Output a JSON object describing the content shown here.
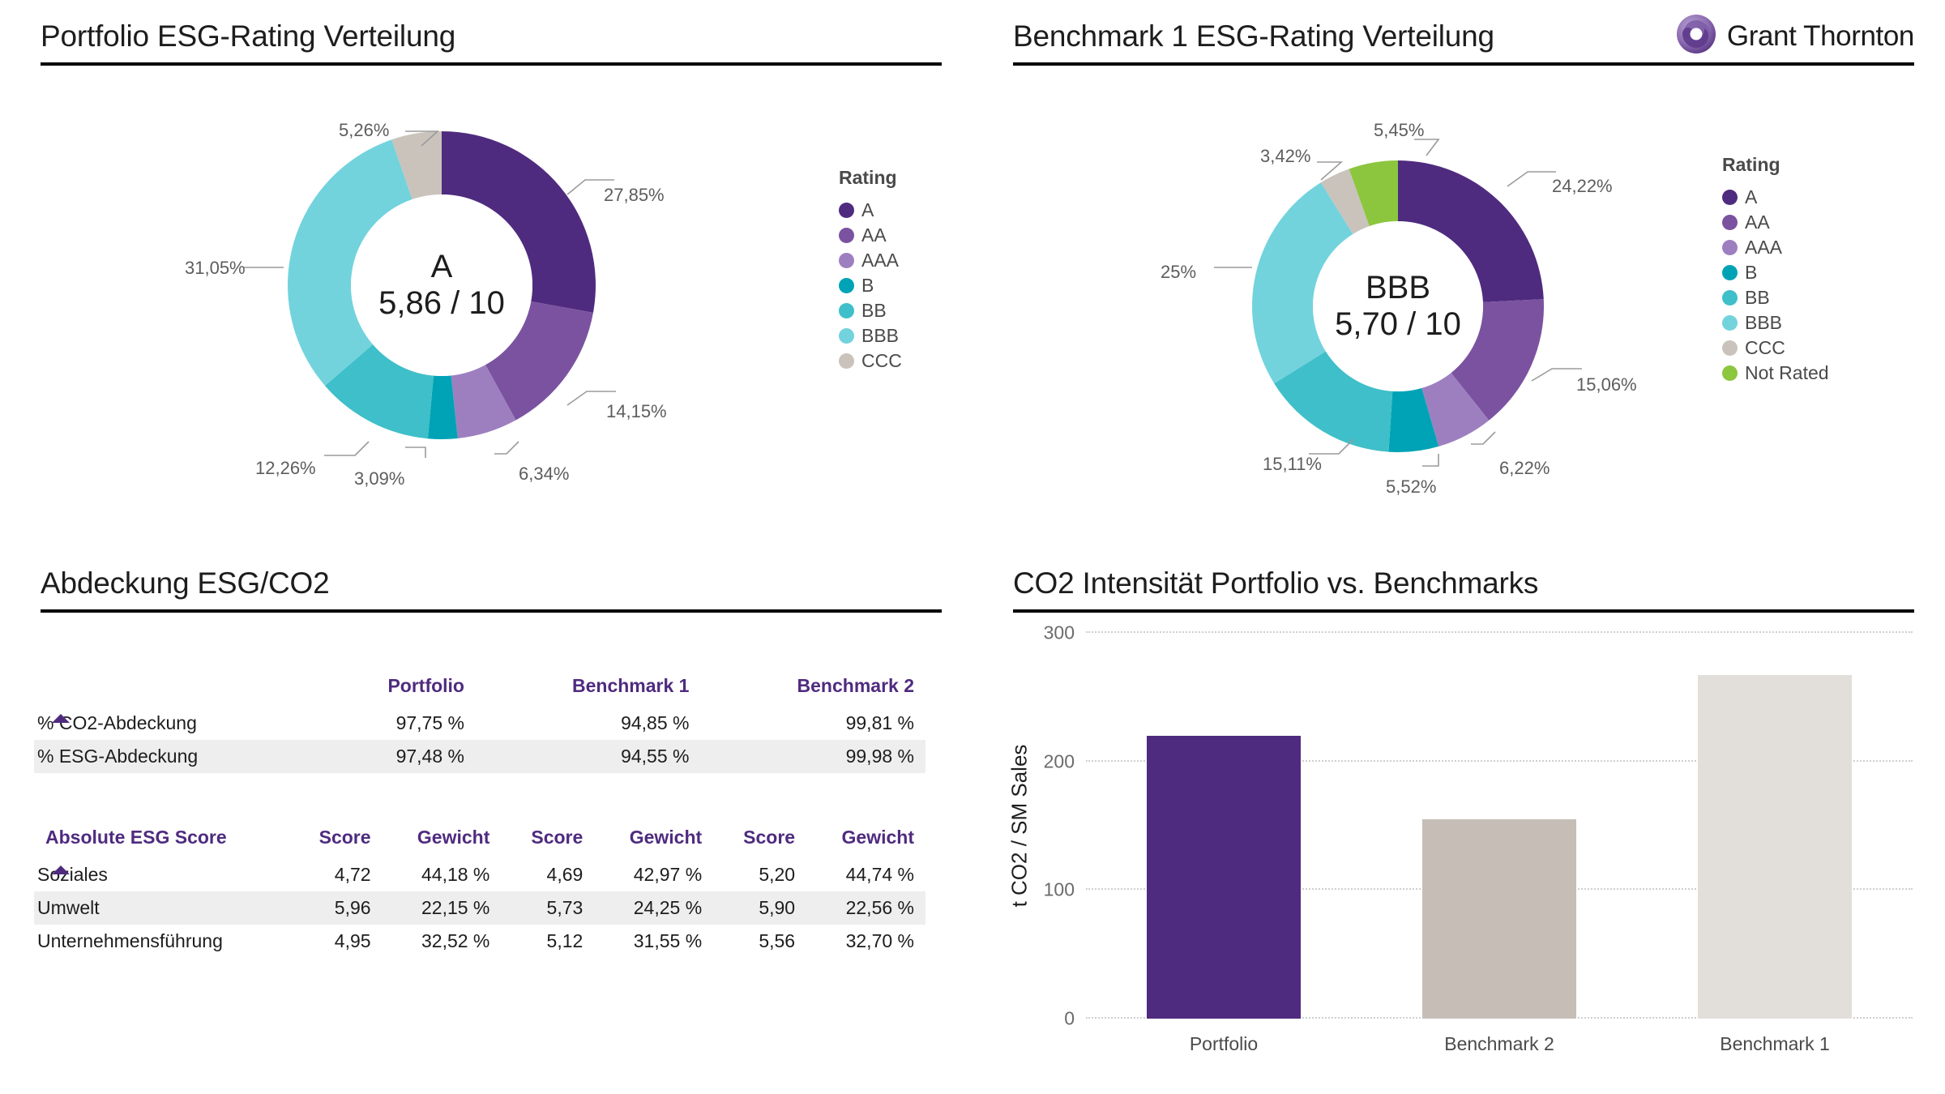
{
  "brand": {
    "name": "Grant Thornton",
    "logo_icon": "grant-thornton-swirl-icon",
    "purple": "#4F2B7F",
    "logo_purple_light": "#9E86C4"
  },
  "panels": {
    "portfolio_rating": {
      "title": "Portfolio ESG-Rating Verteilung"
    },
    "benchmark_rating": {
      "title": "Benchmark 1 ESG-Rating Verteilung"
    },
    "coverage": {
      "title": "Abdeckung ESG/CO2"
    },
    "co2_intensity": {
      "title": "CO2 Intensität Portfolio vs. Benchmarks"
    }
  },
  "legend_title": "Rating",
  "chart_data": [
    {
      "type": "pie",
      "title": "Portfolio ESG-Rating Verteilung",
      "center_rating": "A",
      "center_score": "5,86 / 10",
      "legend_title": "Rating",
      "legend_position": "right",
      "categories": [
        "A",
        "AA",
        "AAA",
        "B",
        "BB",
        "BBB",
        "CCC"
      ],
      "values": [
        27.85,
        14.15,
        6.34,
        3.09,
        12.26,
        31.05,
        5.26
      ],
      "labels": [
        "27,85%",
        "14,15%",
        "6,34%",
        "3,09%",
        "12,26%",
        "31,05%",
        "5,26%"
      ],
      "colors": [
        "#4F2B7F",
        "#7B52A0",
        "#9D7FC0",
        "#00A3B5",
        "#3FBFC9",
        "#72D3DD",
        "#C9C3BC"
      ]
    },
    {
      "type": "pie",
      "title": "Benchmark 1 ESG-Rating Verteilung",
      "center_rating": "BBB",
      "center_score": "5,70 / 10",
      "legend_title": "Rating",
      "legend_position": "right",
      "categories": [
        "A",
        "AA",
        "AAA",
        "B",
        "BB",
        "BBB",
        "CCC",
        "Not Rated"
      ],
      "values": [
        24.22,
        15.06,
        6.22,
        5.52,
        15.11,
        25.0,
        3.42,
        5.45
      ],
      "labels": [
        "24,22%",
        "15,06%",
        "6,22%",
        "5,52%",
        "15,11%",
        "25%",
        "3,42%",
        "5,45%"
      ],
      "colors": [
        "#4F2B7F",
        "#7B52A0",
        "#9D7FC0",
        "#00A3B5",
        "#3FBFC9",
        "#72D3DD",
        "#C9C3BC",
        "#8CC63E"
      ]
    },
    {
      "type": "bar",
      "title": "CO2 Intensität Portfolio vs. Benchmarks",
      "categories": [
        "Portfolio",
        "Benchmark 2",
        "Benchmark 1"
      ],
      "values": [
        220,
        155,
        267
      ],
      "colors": [
        "#4F2B7F",
        "#C6BEB6",
        "#E2DFDB"
      ],
      "xlabel": "",
      "ylabel": "t CO2 / SM Sales",
      "ylim": [
        0,
        300
      ],
      "yticks": [
        0,
        100,
        200,
        300
      ],
      "ytick_labels": [
        "0",
        "100",
        "200",
        "300"
      ],
      "grid": true
    }
  ],
  "coverage_table": {
    "headers": [
      "",
      "Portfolio",
      "Benchmark 1",
      "Benchmark 2"
    ],
    "rows": [
      {
        "label": "% CO2-Abdeckung",
        "values": [
          "97,75 %",
          "94,85 %",
          "99,81 %"
        ]
      },
      {
        "label": "% ESG-Abdeckung",
        "values": [
          "97,48 %",
          "94,55 %",
          "99,98 %"
        ]
      }
    ]
  },
  "score_table": {
    "headers": [
      "Absolute ESG Score",
      "Score",
      "Gewicht",
      "Score",
      "Gewicht",
      "Score",
      "Gewicht"
    ],
    "rows": [
      {
        "label": "Soziales",
        "values": [
          "4,72",
          "44,18 %",
          "4,69",
          "42,97 %",
          "5,20",
          "44,74 %"
        ]
      },
      {
        "label": "Umwelt",
        "values": [
          "5,96",
          "22,15 %",
          "5,73",
          "24,25 %",
          "5,90",
          "22,56 %"
        ]
      },
      {
        "label": "Unternehmensführung",
        "values": [
          "4,95",
          "32,52 %",
          "5,12",
          "31,55 %",
          "5,56",
          "32,70 %"
        ]
      }
    ]
  }
}
